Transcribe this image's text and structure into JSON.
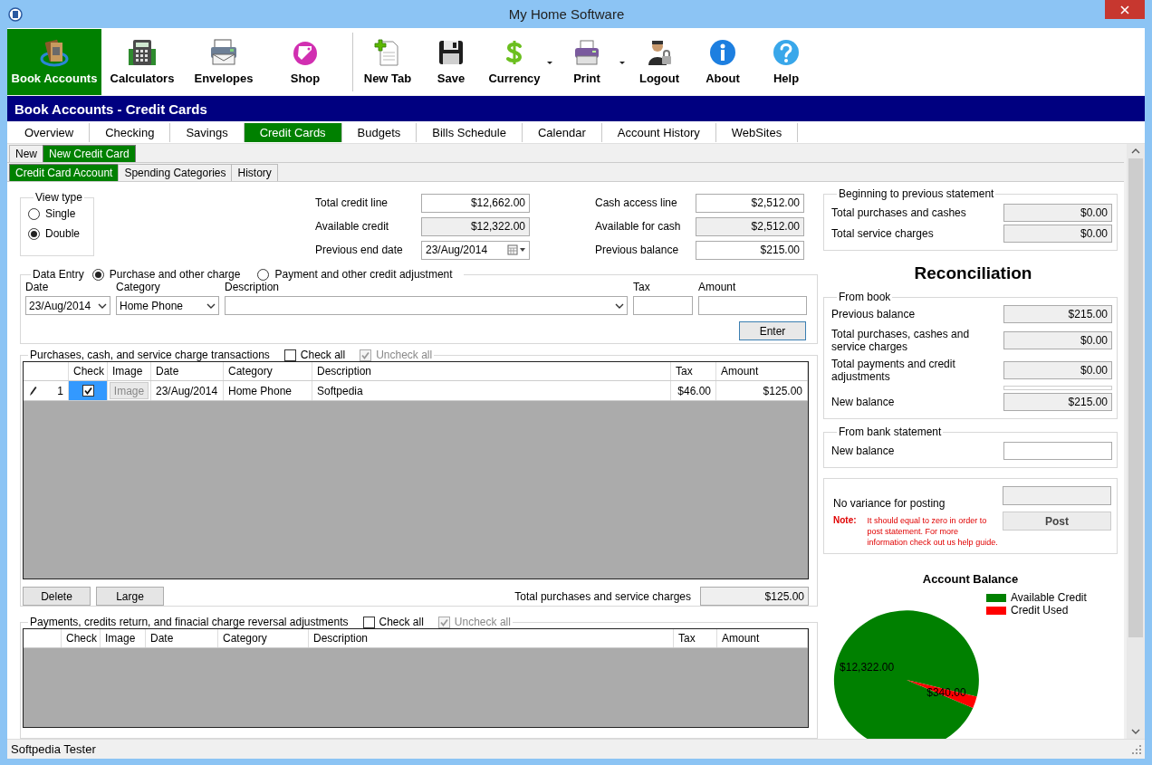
{
  "window": {
    "title": "My Home Software"
  },
  "toolbar": {
    "modules": [
      {
        "label": "Book Accounts",
        "kind": "book",
        "selected": true
      },
      {
        "label": "Calculators",
        "kind": "calculator",
        "selected": false
      },
      {
        "label": "Envelopes",
        "kind": "envelopes",
        "selected": false
      },
      {
        "label": "Shop",
        "kind": "shop",
        "selected": false
      }
    ],
    "actions": [
      {
        "label": "New Tab",
        "kind": "newtab",
        "dropdown": false
      },
      {
        "label": "Save",
        "kind": "save",
        "dropdown": false
      },
      {
        "label": "Currency",
        "kind": "currency",
        "dropdown": true
      },
      {
        "label": "Print",
        "kind": "print",
        "dropdown": true
      },
      {
        "label": "Logout",
        "kind": "logout",
        "dropdown": false
      },
      {
        "label": "About",
        "kind": "about",
        "dropdown": false
      },
      {
        "label": "Help",
        "kind": "help",
        "dropdown": false
      }
    ]
  },
  "header": {
    "title": "Book Accounts - Credit Cards"
  },
  "tabs": [
    {
      "label": "Overview",
      "selected": false
    },
    {
      "label": "Checking",
      "selected": false
    },
    {
      "label": "Savings",
      "selected": false
    },
    {
      "label": "Credit Cards",
      "selected": true
    },
    {
      "label": "Budgets",
      "selected": false
    },
    {
      "label": "Bills Schedule",
      "selected": false
    },
    {
      "label": "Calendar",
      "selected": false
    },
    {
      "label": "Account History",
      "selected": false
    },
    {
      "label": "WebSites",
      "selected": false
    }
  ],
  "subtabs": [
    {
      "label": "New",
      "selected": false
    },
    {
      "label": "New Credit Card",
      "selected": true
    }
  ],
  "page_tabs": [
    {
      "label": "Credit Card Account",
      "selected": true
    },
    {
      "label": "Spending Categories",
      "selected": false
    },
    {
      "label": "History",
      "selected": false
    }
  ],
  "view_type": {
    "title": "View type",
    "options": [
      {
        "label": "Single",
        "selected": false
      },
      {
        "label": "Double",
        "selected": true
      }
    ]
  },
  "summary": {
    "left": [
      {
        "label": "Total credit line",
        "value": "$12,662.00",
        "kind": "input"
      },
      {
        "label": "Available credit",
        "value": "$12,322.00",
        "kind": "readonly"
      },
      {
        "label": "Previous end date",
        "value": "23/Aug/2014",
        "kind": "date"
      }
    ],
    "right": [
      {
        "label": "Cash access line",
        "value": "$2,512.00",
        "kind": "input"
      },
      {
        "label": "Available for cash",
        "value": "$2,512.00",
        "kind": "readonly"
      },
      {
        "label": "Previous balance",
        "value": "$215.00",
        "kind": "input"
      }
    ]
  },
  "data_entry": {
    "title": "Data Entry",
    "modes": [
      {
        "label": "Purchase and other charge",
        "selected": true
      },
      {
        "label": "Payment and other credit adjustment",
        "selected": false
      }
    ],
    "fields": [
      {
        "label": "Date",
        "value": "23/Aug/2014",
        "kind": "combo"
      },
      {
        "label": "Category",
        "value": "Home Phone",
        "kind": "combo"
      },
      {
        "label": "Description",
        "kind": "combo"
      },
      {
        "label": "Tax",
        "kind": "input"
      },
      {
        "label": "Amount",
        "kind": "input"
      }
    ],
    "button": "Enter"
  },
  "purchases": {
    "title": "Purchases, cash,  and service charge transactions",
    "toggles": [
      {
        "label": "Check all",
        "checked": false,
        "disabled": false
      },
      {
        "label": "Uncheck all",
        "checked": true,
        "disabled": true
      }
    ],
    "columns": [
      "Check",
      "Image",
      "Date",
      "Category",
      "Description",
      "Tax",
      "Amount"
    ],
    "rows": [
      {
        "number": "1",
        "editing": true,
        "checked": true,
        "image": "Image",
        "date": "23/Aug/2014",
        "category": "Home Phone",
        "description": "Softpedia",
        "tax": "$46.00",
        "amount": "$125.00"
      }
    ],
    "buttons": [
      "Delete",
      "Large"
    ],
    "total_label": "Total purchases and service charges",
    "total": "$125.00"
  },
  "payments": {
    "title": "Payments, credits return, and finacial charge reversal adjustments",
    "toggles": [
      {
        "label": "Check all",
        "checked": false,
        "disabled": false
      },
      {
        "label": "Uncheck all",
        "checked": true,
        "disabled": true
      }
    ],
    "columns": [
      "Check",
      "Image",
      "Date",
      "Category",
      "Description",
      "Tax",
      "Amount"
    ]
  },
  "beginning": {
    "title": "Beginning to previous statement",
    "rows": [
      {
        "label": "Total  purchases and cashes",
        "value": "$0.00"
      },
      {
        "label": "Total service charges",
        "value": "$0.00"
      }
    ]
  },
  "reconciliation": {
    "title": "Reconciliation",
    "from_book": {
      "title": "From book",
      "rows": [
        {
          "label": "Previous balance",
          "value": "$215.00"
        },
        {
          "label": "Total purchases, cashes and service charges",
          "value": "$0.00"
        },
        {
          "label": "Total payments and credit adjustments",
          "value": "$0.00"
        },
        {
          "label": "New balance",
          "value": "$215.00"
        }
      ]
    },
    "from_bank": {
      "title": "From bank statement",
      "rows": [
        {
          "label": "New balance"
        }
      ]
    },
    "posting": {
      "label": "No variance for posting",
      "note_label": "Note:",
      "note": "It should equal to zero in order to post statement. For more information check out us help guide.",
      "button": "Post"
    }
  },
  "account_balance": {
    "chart_data": {
      "type": "pie",
      "title": "Account Balance",
      "categories": [
        "Available Credit",
        "Credit Used"
      ],
      "values": [
        12322,
        340
      ],
      "colors": [
        "#008000",
        "#ff0000"
      ],
      "legend": "top-right",
      "value_labels": [
        "$12,322.00",
        "$340.00"
      ]
    }
  },
  "status_bar": {
    "text": "Softpedia Tester"
  }
}
